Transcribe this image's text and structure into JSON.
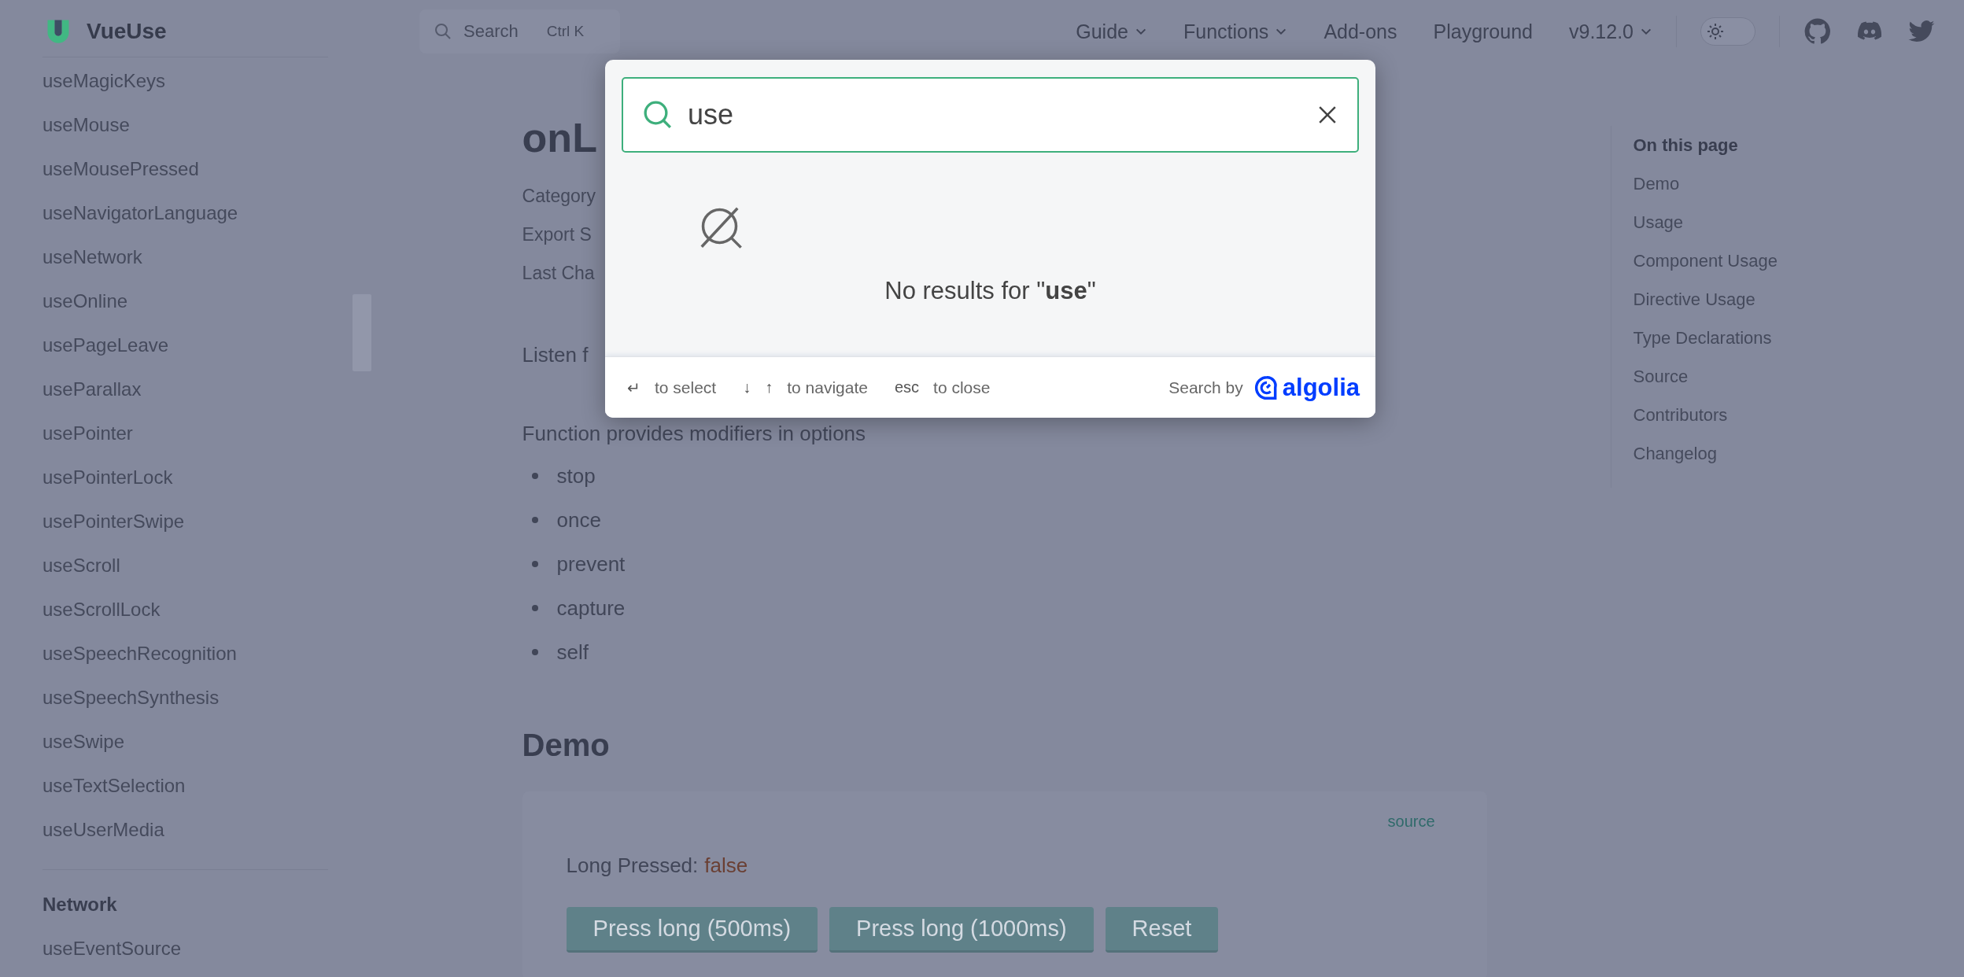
{
  "nav": {
    "logo": "VueUse",
    "search": {
      "placeholder": "Search",
      "shortcut": "Ctrl K"
    },
    "links": [
      {
        "label": "Guide",
        "dropdown": true
      },
      {
        "label": "Functions",
        "dropdown": true
      },
      {
        "label": "Add-ons",
        "dropdown": false
      },
      {
        "label": "Playground",
        "dropdown": false
      },
      {
        "label": "v9.12.0",
        "dropdown": true
      }
    ],
    "dark_mode": false
  },
  "sidebar": {
    "items": [
      "useMagicKeys",
      "useMouse",
      "useMousePressed",
      "useNavigatorLanguage",
      "useNetwork",
      "useOnline",
      "usePageLeave",
      "useParallax",
      "usePointer",
      "usePointerLock",
      "usePointerSwipe",
      "useScroll",
      "useScrollLock",
      "useSpeechRecognition",
      "useSpeechSynthesis",
      "useSwipe",
      "useTextSelection",
      "useUserMedia"
    ],
    "sections": [
      {
        "title": "Network",
        "items": [
          "useEventSource"
        ]
      }
    ]
  },
  "content": {
    "title": "onL",
    "meta": [
      "Category",
      "Export S",
      "Last Cha"
    ],
    "intro": "Listen f",
    "description": "Function provides modifiers in options",
    "modifiers": [
      "stop",
      "once",
      "prevent",
      "capture",
      "self"
    ],
    "demo": {
      "heading": "Demo",
      "source_link": "source",
      "label": "Long Pressed:",
      "value": "false",
      "buttons": [
        "Press long (500ms)",
        "Press long (1000ms)",
        "Reset"
      ]
    }
  },
  "toc": {
    "title": "On this page",
    "items": [
      "Demo",
      "Usage",
      "Component Usage",
      "Directive Usage",
      "Type Declarations",
      "Source",
      "Contributors",
      "Changelog"
    ]
  },
  "search_modal": {
    "query": "use",
    "message": "No results for \"**use**\"",
    "footer": [
      {
        "keys": [
          "↵"
        ],
        "label": "to select"
      },
      {
        "keys": [
          "↓",
          "↑"
        ],
        "label": "to navigate"
      },
      {
        "keys": [
          "esc"
        ],
        "label": "to close"
      }
    ],
    "powered_by": "Search by",
    "brand": "algolia"
  }
}
